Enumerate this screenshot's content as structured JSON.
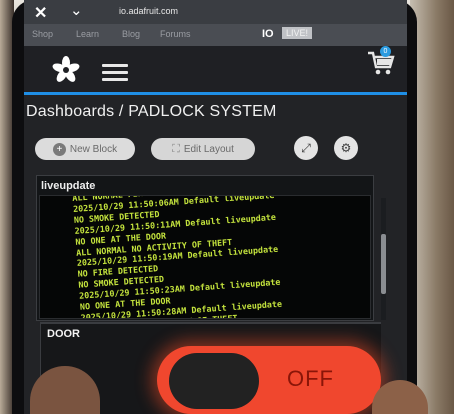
{
  "browser": {
    "url": "io.adafruit.com"
  },
  "top_nav": {
    "items": [
      "Shop",
      "Learn",
      "Blog",
      "Forums"
    ],
    "io_label": "IO",
    "live_label": "LIVE!"
  },
  "cart": {
    "badge": "0"
  },
  "page": {
    "title": "Dashboards / PADLOCK SYSTEM"
  },
  "toolbar": {
    "new_block": "New Block",
    "edit_layout": "Edit Layout"
  },
  "liveupdate": {
    "title": "liveupdate",
    "lines": [
      "ALL NORMAL FIRE DETECTED",
      "2025/10/29 11:50:06AM Default liveupdate",
      "NO SMOKE DETECTED",
      "2025/10/29 11:50:11AM Default liveupdate",
      "NO ONE AT THE DOOR",
      "ALL NORMAL NO ACTIVITY OF THEFT",
      "2025/10/29 11:50:19AM Default liveupdate",
      "NO FIRE DETECTED",
      "NO SMOKE DETECTED",
      "2025/10/29 11:50:23AM Default liveupdate",
      "NO ONE AT THE DOOR",
      "2025/10/29 11:50:28AM Default liveupdate",
      "ALL NORMAL NO ACTIVITY OF THEFT"
    ]
  },
  "door": {
    "title": "DOOR",
    "state": "OFF",
    "on": false
  },
  "colors": {
    "accent_blue": "#1f8fe6",
    "feed_text": "#c3e23d",
    "toggle_off": "#f0472e"
  }
}
